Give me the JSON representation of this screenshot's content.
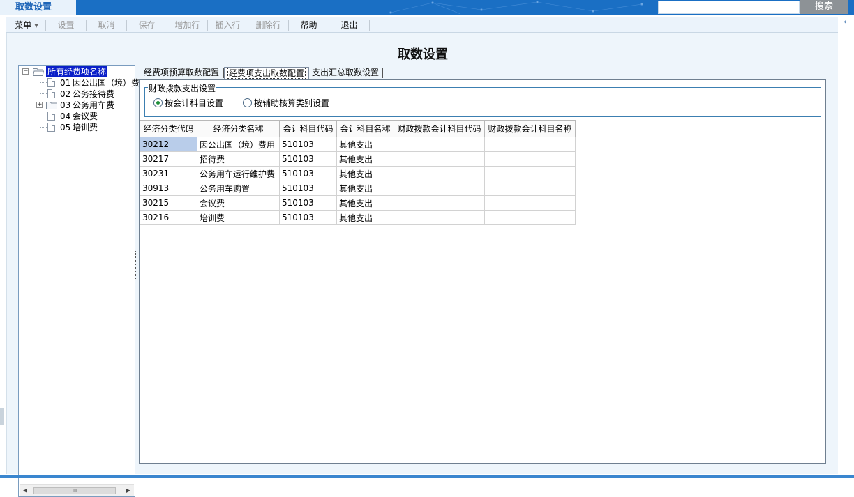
{
  "app": {
    "tab_label": "取数设置"
  },
  "search": {
    "value": "",
    "button_label": "搜索"
  },
  "toolbar": {
    "items": [
      {
        "label": "菜单",
        "enabled": true
      },
      {
        "label": "设置",
        "enabled": false
      },
      {
        "label": "取消",
        "enabled": false
      },
      {
        "label": "保存",
        "enabled": false
      },
      {
        "label": "增加行",
        "enabled": false
      },
      {
        "label": "插入行",
        "enabled": false
      },
      {
        "label": "删除行",
        "enabled": false
      },
      {
        "label": "帮助",
        "enabled": true
      },
      {
        "label": "退出",
        "enabled": true
      }
    ]
  },
  "page": {
    "title": "取数设置"
  },
  "tree": {
    "root": "所有经费项名称",
    "items": [
      {
        "code": "01",
        "name": "因公出国（境）费"
      },
      {
        "code": "02",
        "name": "公务接待费"
      },
      {
        "code": "03",
        "name": "公务用车费"
      },
      {
        "code": "04",
        "name": "会议费"
      },
      {
        "code": "05",
        "name": "培训费"
      }
    ],
    "scroll_thumb": "III"
  },
  "tabs": [
    {
      "label": "经费项预算取数配置",
      "active": false
    },
    {
      "label": "经费项支出取数配置",
      "active": true
    },
    {
      "label": "支出汇总取数设置",
      "active": false
    }
  ],
  "settings": {
    "group_title": "财政拨款支出设置",
    "radio_options": [
      {
        "label": "按会计科目设置",
        "checked": true
      },
      {
        "label": "按辅助核算类别设置",
        "checked": false
      }
    ]
  },
  "grid": {
    "columns": [
      "经济分类代码",
      "经济分类名称",
      "会计科目代码",
      "会计科目名称",
      "财政拨款会计科目代码",
      "财政拨款会计科目名称"
    ],
    "rows": [
      [
        "30212",
        "因公出国（境）费用",
        "510103",
        "其他支出",
        "",
        ""
      ],
      [
        "30217",
        "招待费",
        "510103",
        "其他支出",
        "",
        ""
      ],
      [
        "30231",
        "公务用车运行维护费",
        "510103",
        "其他支出",
        "",
        ""
      ],
      [
        "30913",
        "公务用车购置",
        "510103",
        "其他支出",
        "",
        ""
      ],
      [
        "30215",
        "会议费",
        "510103",
        "其他支出",
        "",
        ""
      ],
      [
        "30216",
        "培训费",
        "510103",
        "其他支出",
        "",
        ""
      ]
    ]
  },
  "colors": {
    "header_blue": "#1a6fc4",
    "selection": "#0a1fc8",
    "radio_dot": "#1e8f3a"
  }
}
